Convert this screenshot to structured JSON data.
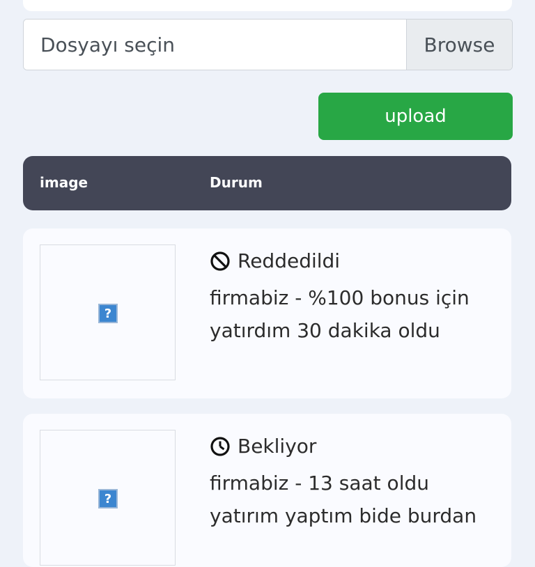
{
  "upload_form": {
    "file_placeholder": "Dosyayı seçin",
    "browse_label": "Browse",
    "upload_label": "upload",
    "upload_color": "#28a745"
  },
  "table": {
    "headers": [
      "image",
      "Durum"
    ],
    "header_color": "#434656",
    "rows": [
      {
        "image_icon": "broken-image-icon",
        "status_icon": "ban-icon",
        "status": "Reddedildi",
        "message": "firmabiz - %100 bonus için yatırdım 30 dakika oldu"
      },
      {
        "image_icon": "broken-image-icon",
        "status_icon": "clock-icon",
        "status": "Bekliyor",
        "message": "firmabiz - 13 saat oldu yatırım yaptım bide burdan"
      }
    ]
  }
}
